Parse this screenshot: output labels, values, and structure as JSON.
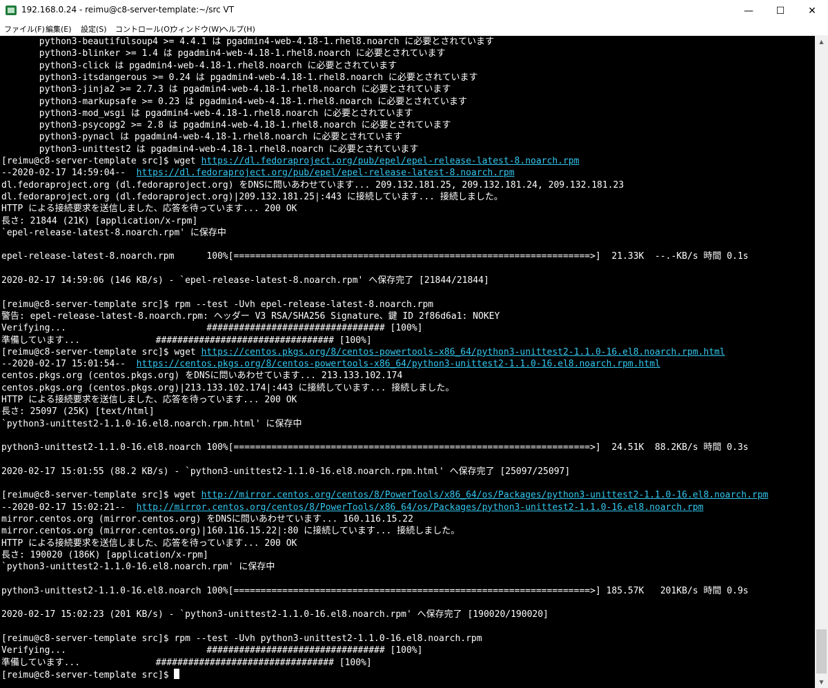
{
  "window": {
    "title": "192.168.0.24 - reimu@c8-server-template:~/src VT",
    "minimize_glyph": "—",
    "maximize_glyph": "☐",
    "close_glyph": "✕"
  },
  "menu": [
    "ファイル(F)",
    "編集(E)",
    "設定(S)",
    "コントロール(O)",
    "ウィンドウ(W)",
    "ヘルプ(H)"
  ],
  "terminal": {
    "lines": [
      {
        "a": "       python3-beautifulsoup4 >= 4.4.1 は pgadmin4-web-4.18-1.rhel8.noarch に必要とされています"
      },
      {
        "a": "       python3-blinker >= 1.4 は pgadmin4-web-4.18-1.rhel8.noarch に必要とされています"
      },
      {
        "a": "       python3-click は pgadmin4-web-4.18-1.rhel8.noarch に必要とされています"
      },
      {
        "a": "       python3-itsdangerous >= 0.24 は pgadmin4-web-4.18-1.rhel8.noarch に必要とされています"
      },
      {
        "a": "       python3-jinja2 >= 2.7.3 は pgadmin4-web-4.18-1.rhel8.noarch に必要とされています"
      },
      {
        "a": "       python3-markupsafe >= 0.23 は pgadmin4-web-4.18-1.rhel8.noarch に必要とされています"
      },
      {
        "a": "       python3-mod_wsgi は pgadmin4-web-4.18-1.rhel8.noarch に必要とされています"
      },
      {
        "a": "       python3-psycopg2 >= 2.8 は pgadmin4-web-4.18-1.rhel8.noarch に必要とされています"
      },
      {
        "a": "       python3-pynacl は pgadmin4-web-4.18-1.rhel8.noarch に必要とされています"
      },
      {
        "a": "       python3-unittest2 は pgadmin4-web-4.18-1.rhel8.noarch に必要とされています"
      },
      {
        "a": "[reimu@c8-server-template src]$ wget ",
        "link": "https://dl.fedoraproject.org/pub/epel/epel-release-latest-8.noarch.rpm"
      },
      {
        "a": "--2020-02-17 14:59:04--  ",
        "link": "https://dl.fedoraproject.org/pub/epel/epel-release-latest-8.noarch.rpm"
      },
      {
        "a": "dl.fedoraproject.org (dl.fedoraproject.org) をDNSに問いあわせています... 209.132.181.25, 209.132.181.24, 209.132.181.23"
      },
      {
        "a": "dl.fedoraproject.org (dl.fedoraproject.org)|209.132.181.25|:443 に接続しています... 接続しました。"
      },
      {
        "a": "HTTP による接続要求を送信しました、応答を待っています... 200 OK"
      },
      {
        "a": "長さ: 21844 (21K) [application/x-rpm]"
      },
      {
        "a": "`epel-release-latest-8.noarch.rpm' に保存中"
      },
      {
        "a": ""
      },
      {
        "a": "epel-release-latest-8.noarch.rpm      100%[==================================================================>]  21.33K  --.-KB/s 時間 0.1s"
      },
      {
        "a": ""
      },
      {
        "a": "2020-02-17 14:59:06 (146 KB/s) - `epel-release-latest-8.noarch.rpm' へ保存完了 [21844/21844]"
      },
      {
        "a": ""
      },
      {
        "a": "[reimu@c8-server-template src]$ rpm --test -Uvh epel-release-latest-8.noarch.rpm"
      },
      {
        "a": "警告: epel-release-latest-8.noarch.rpm: ヘッダー V3 RSA/SHA256 Signature、鍵 ID 2f86d6a1: NOKEY"
      },
      {
        "a": "Verifying...                          ################################# [100%]"
      },
      {
        "a": "準備しています...              ################################# [100%]"
      },
      {
        "a": "[reimu@c8-server-template src]$ wget ",
        "link": "https://centos.pkgs.org/8/centos-powertools-x86_64/python3-unittest2-1.1.0-16.el8.noarch.rpm.html"
      },
      {
        "a": "--2020-02-17 15:01:54--  ",
        "link": "https://centos.pkgs.org/8/centos-powertools-x86_64/python3-unittest2-1.1.0-16.el8.noarch.rpm.html"
      },
      {
        "a": "centos.pkgs.org (centos.pkgs.org) をDNSに問いあわせています... 213.133.102.174"
      },
      {
        "a": "centos.pkgs.org (centos.pkgs.org)|213.133.102.174|:443 に接続しています... 接続しました。"
      },
      {
        "a": "HTTP による接続要求を送信しました、応答を待っています... 200 OK"
      },
      {
        "a": "長さ: 25097 (25K) [text/html]"
      },
      {
        "a": "`python3-unittest2-1.1.0-16.el8.noarch.rpm.html' に保存中"
      },
      {
        "a": ""
      },
      {
        "a": "python3-unittest2-1.1.0-16.el8.noarch 100%[==================================================================>]  24.51K  88.2KB/s 時間 0.3s"
      },
      {
        "a": ""
      },
      {
        "a": "2020-02-17 15:01:55 (88.2 KB/s) - `python3-unittest2-1.1.0-16.el8.noarch.rpm.html' へ保存完了 [25097/25097]"
      },
      {
        "a": ""
      },
      {
        "a": "[reimu@c8-server-template src]$ wget ",
        "link": "http://mirror.centos.org/centos/8/PowerTools/x86_64/os/Packages/python3-unittest2-1.1.0-16.el8.noarch.rpm"
      },
      {
        "a": "--2020-02-17 15:02:21--  ",
        "link": "http://mirror.centos.org/centos/8/PowerTools/x86_64/os/Packages/python3-unittest2-1.1.0-16.el8.noarch.rpm"
      },
      {
        "a": "mirror.centos.org (mirror.centos.org) をDNSに問いあわせています... 160.116.15.22"
      },
      {
        "a": "mirror.centos.org (mirror.centos.org)|160.116.15.22|:80 に接続しています... 接続しました。"
      },
      {
        "a": "HTTP による接続要求を送信しました、応答を待っています... 200 OK"
      },
      {
        "a": "長さ: 190020 (186K) [application/x-rpm]"
      },
      {
        "a": "`python3-unittest2-1.1.0-16.el8.noarch.rpm' に保存中"
      },
      {
        "a": ""
      },
      {
        "a": "python3-unittest2-1.1.0-16.el8.noarch 100%[==================================================================>] 185.57K   201KB/s 時間 0.9s"
      },
      {
        "a": ""
      },
      {
        "a": "2020-02-17 15:02:23 (201 KB/s) - `python3-unittest2-1.1.0-16.el8.noarch.rpm' へ保存完了 [190020/190020]"
      },
      {
        "a": ""
      },
      {
        "a": "[reimu@c8-server-template src]$ rpm --test -Uvh python3-unittest2-1.1.0-16.el8.noarch.rpm"
      },
      {
        "a": "Verifying...                          ################################# [100%]"
      },
      {
        "a": "準備しています...              ################################# [100%]"
      },
      {
        "a": "[reimu@c8-server-template src]$ ",
        "cursor": true
      }
    ]
  }
}
